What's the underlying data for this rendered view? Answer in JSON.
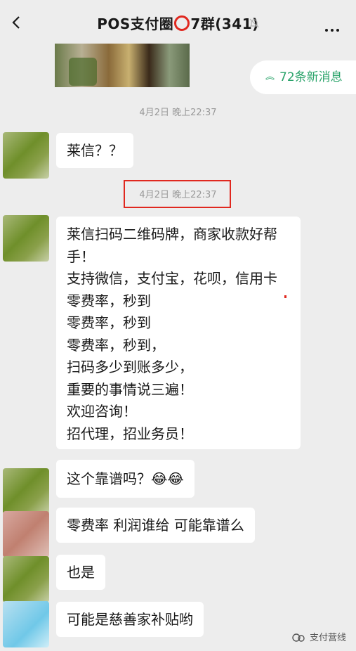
{
  "header": {
    "title_prefix": "POS支付圈",
    "title_suffix": "7群(341)"
  },
  "new_messages": {
    "label": "72条新消息"
  },
  "timestamps": [
    "4月2日 晚上22:37",
    "4月2日 晚上22:37"
  ],
  "messages": [
    {
      "text": "莱信？？"
    },
    {
      "lines": [
        "莱信扫码二维码牌，商家收款好帮",
        "手！",
        "支持微信，支付宝，花呗，信用卡",
        "零费率，秒到",
        "零费率，秒到",
        "零费率，秒到，",
        "扫码多少到账多少，",
        "重要的事情说三遍！",
        "欢迎咨询！",
        "招代理，招业务员！"
      ]
    },
    {
      "text": "这个靠谱吗？😂😂"
    },
    {
      "text": "零费率 利润谁给 可能靠谱么"
    },
    {
      "text": "也是"
    },
    {
      "text": "可能是慈善家补贴哟"
    }
  ],
  "watermark": {
    "label": "支付营线"
  },
  "colors": {
    "accent_green": "#2aa36a",
    "highlight_red": "#e0281f",
    "background": "#ededed"
  }
}
